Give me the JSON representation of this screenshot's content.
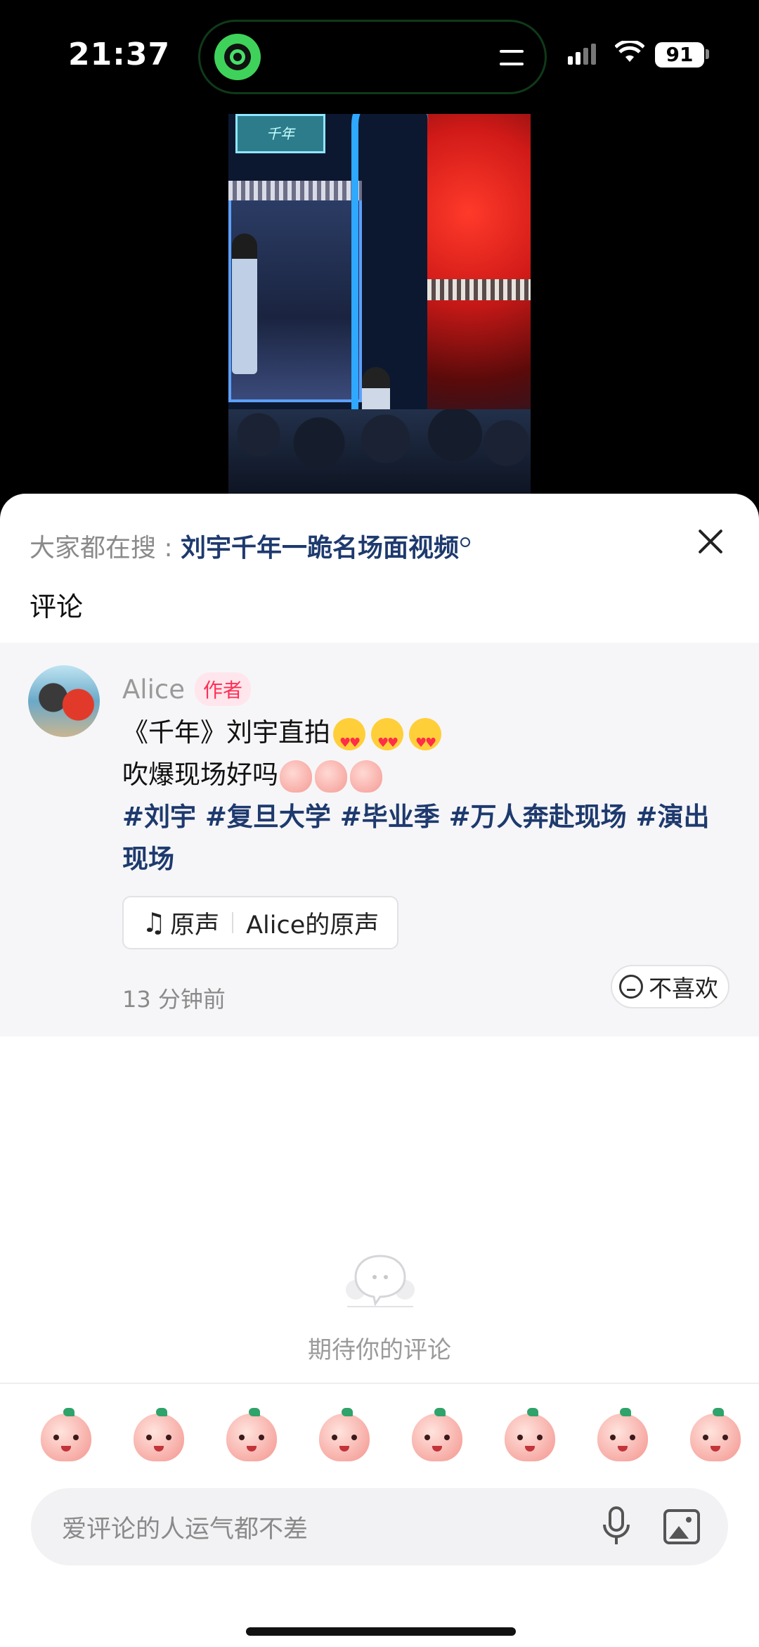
{
  "status_bar": {
    "time": "21:37",
    "battery": "91",
    "island_app_icon": "green-app-icon",
    "island_menu_icon": "menu-lines-icon"
  },
  "video": {
    "sign_text": "千年"
  },
  "sheet": {
    "search_prefix": "大家都在搜 : ",
    "search_query": "刘宇千年一跪名场面视频",
    "comments_title": "评论"
  },
  "post": {
    "author": "Alice",
    "author_badge": "作者",
    "line1": "《千年》刘宇直拍",
    "line2": "吹爆现场好吗",
    "hashtags": "#刘宇 #复旦大学 #毕业季 #万人奔赴现场 #演出现场",
    "music_label": "原声",
    "music_source": "Alice的原声",
    "time": "13 分钟前",
    "dislike_label": "不喜欢"
  },
  "empty_state": {
    "text": "期待你的评论"
  },
  "composer": {
    "placeholder": "爱评论的人运气都不差"
  },
  "colors": {
    "link": "#1e3a6e",
    "badge": "#ff2f55",
    "muted": "#8a8a8a"
  }
}
